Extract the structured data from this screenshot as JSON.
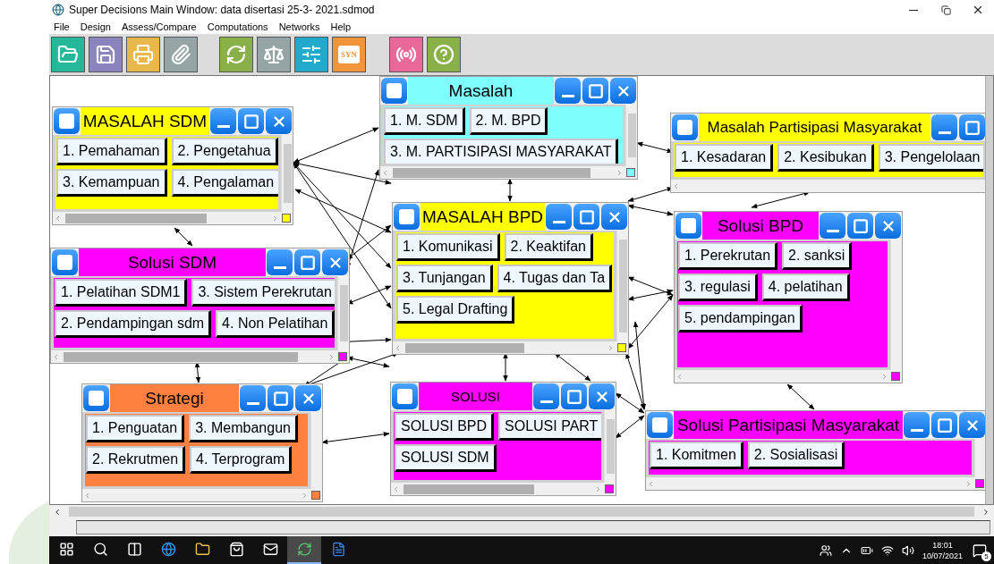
{
  "window": {
    "title": "Super Decisions Main Window: data disertasi 25-3- 2021.sdmod"
  },
  "menu": [
    "File",
    "Design",
    "Assess/Compare",
    "Computations",
    "Networks",
    "Help"
  ],
  "toolbar": [
    {
      "kind": "open"
    },
    {
      "kind": "save"
    },
    {
      "kind": "print"
    },
    {
      "kind": "attach"
    },
    {
      "kind": "update"
    },
    {
      "kind": "compare"
    },
    {
      "kind": "settings"
    },
    {
      "kind": "synthesize",
      "label": "SYN"
    },
    {
      "kind": "broadcast"
    },
    {
      "kind": "help"
    }
  ],
  "clusters": [
    {
      "title": "Masalah",
      "color": "#80ffff",
      "node_rows": [
        [
          "1. M. SDM",
          "2. M. BPD"
        ],
        [
          "3. M. PARTISIPASI MASYARAKAT"
        ]
      ]
    },
    {
      "title": "MASALAH SDM",
      "color": "#ffff00",
      "node_rows": [
        [
          "1. Pemahaman",
          "2. Pengetahua"
        ],
        [
          "3. Kemampuan",
          "4. Pengalaman"
        ]
      ]
    },
    {
      "title": "Masalah Partisipasi Masyarakat",
      "color": "#ffff00",
      "node_rows": [
        [
          "1. Kesadaran",
          "2. Kesibukan",
          "3. Pengelolaan"
        ]
      ]
    },
    {
      "title": "MASALAH BPD",
      "color": "#ffff00",
      "node_rows": [
        [
          "1. Komunikasi",
          "2. Keaktifan"
        ],
        [
          "3. Tunjangan",
          "4. Tugas dan Ta"
        ],
        [
          "5. Legal Drafting"
        ]
      ]
    },
    {
      "title": "Solusi SDM",
      "color": "#ff00ff",
      "node_rows": [
        [
          "1. Pelatihan SDM1",
          "3. Sistem Perekrutan"
        ],
        [
          "2. Pendampingan sdm",
          "4. Non Pelatihan"
        ]
      ]
    },
    {
      "title": "Solusi BPD",
      "color": "#ff00ff",
      "node_rows": [
        [
          "1. Perekrutan",
          "2. sanksi"
        ],
        [
          "3. regulasi",
          "4. pelatihan"
        ],
        [
          "5. pendampingan"
        ]
      ]
    },
    {
      "title": "Strategi",
      "color": "#ff8040",
      "node_rows": [
        [
          "1. Penguatan",
          "3. Membangun"
        ],
        [
          "2. Rekrutmen",
          "4. Terprogram"
        ]
      ]
    },
    {
      "title": "SOLUSI",
      "color": "#ff00ff",
      "node_rows": [
        [
          "SOLUSI BPD",
          "SOLUSI PART"
        ],
        [
          "SOLUSI SDM"
        ]
      ]
    },
    {
      "title": "Solusi Partisipasi Masyarakat",
      "color": "#ff00ff",
      "node_rows": [
        [
          "1. Komitmen",
          "2. Sosialisasi"
        ]
      ]
    }
  ],
  "taskbar": {
    "apps": [
      {
        "kind": "start",
        "selected": false
      },
      {
        "kind": "search",
        "selected": false
      },
      {
        "kind": "taskview",
        "selected": false
      },
      {
        "kind": "browser",
        "selected": false
      },
      {
        "kind": "files",
        "selected": false
      },
      {
        "kind": "store",
        "selected": false
      },
      {
        "kind": "mail",
        "selected": false
      },
      {
        "kind": "superdecisions",
        "selected": true
      },
      {
        "kind": "word",
        "selected": false
      }
    ],
    "time": "18:01",
    "date": "10/07/2021",
    "notifications": "5"
  }
}
